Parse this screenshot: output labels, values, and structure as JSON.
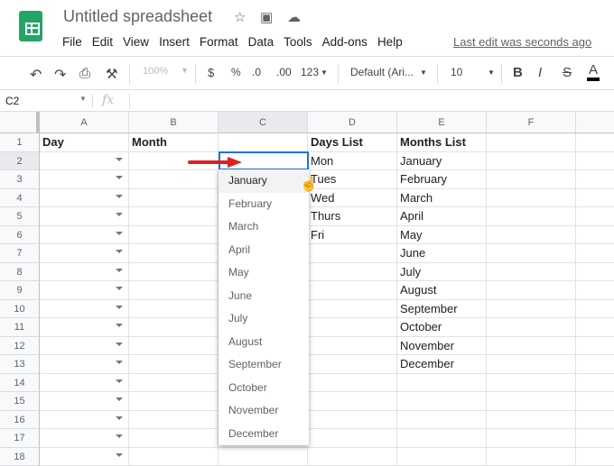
{
  "app": {
    "title": "Untitled spreadsheet",
    "last_edit": "Last edit was seconds ago",
    "menu": [
      "File",
      "Edit",
      "View",
      "Insert",
      "Format",
      "Data",
      "Tools",
      "Add-ons",
      "Help"
    ]
  },
  "toolbar": {
    "zoom": "100%",
    "currency": "$",
    "percent": "%",
    "dec_less": ".0",
    "dec_more": ".00",
    "number_format": "123",
    "font": "Default (Ari...",
    "font_size": "10",
    "bold": "B",
    "italic": "I",
    "strike": "S",
    "text_color": "A",
    "text_color_value": "#000000"
  },
  "formula_bar": {
    "cell_ref": "C2",
    "fx": "fx",
    "value": ""
  },
  "grid": {
    "columns": [
      "A",
      "B",
      "C",
      "D",
      "E",
      "F"
    ],
    "rows": [
      [
        "Day",
        "Month",
        "",
        "Days List",
        "Months List",
        ""
      ],
      [
        "",
        "",
        "",
        "Mon",
        "January",
        ""
      ],
      [
        "",
        "",
        "",
        "Tues",
        "February",
        ""
      ],
      [
        "",
        "",
        "",
        "Wed",
        "March",
        ""
      ],
      [
        "",
        "",
        "",
        "Thurs",
        "April",
        ""
      ],
      [
        "",
        "",
        "",
        "Fri",
        "May",
        ""
      ],
      [
        "",
        "",
        "",
        "",
        "June",
        ""
      ],
      [
        "",
        "",
        "",
        "",
        "July",
        ""
      ],
      [
        "",
        "",
        "",
        "",
        "August",
        ""
      ],
      [
        "",
        "",
        "",
        "",
        "September",
        ""
      ],
      [
        "",
        "",
        "",
        "",
        "October",
        ""
      ],
      [
        "",
        "",
        "",
        "",
        "November",
        ""
      ],
      [
        "",
        "",
        "",
        "",
        "December",
        ""
      ],
      [
        "",
        "",
        "",
        "",
        "",
        ""
      ],
      [
        "",
        "",
        "",
        "",
        "",
        ""
      ],
      [
        "",
        "",
        "",
        "",
        "",
        ""
      ],
      [
        "",
        "",
        "",
        "",
        "",
        ""
      ],
      [
        "",
        "",
        "",
        "",
        "",
        ""
      ]
    ]
  },
  "dropdown": {
    "options": [
      "January",
      "February",
      "March",
      "April",
      "May",
      "June",
      "July",
      "August",
      "September",
      "October",
      "November",
      "December"
    ],
    "highlighted": "January"
  },
  "colors": {
    "accent": "#1a73e8",
    "arrow": "#e02020",
    "sheets_green": "#23a566"
  }
}
